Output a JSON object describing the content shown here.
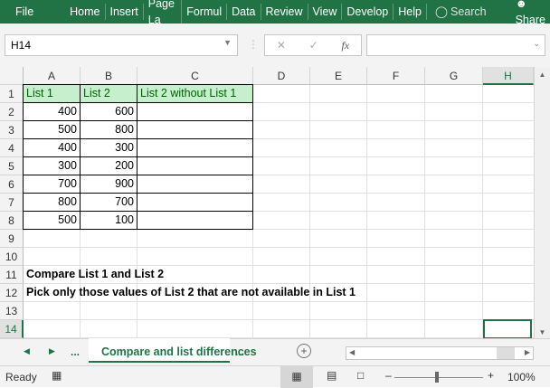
{
  "ribbon": {
    "tabs": [
      "File",
      "Home",
      "Insert",
      "Page La",
      "Formul",
      "Data",
      "Review",
      "View",
      "Develop",
      "Help"
    ],
    "search": "Search",
    "share": "Share"
  },
  "formula_bar": {
    "name_box": "H14",
    "value": ""
  },
  "columns": [
    "A",
    "B",
    "C",
    "D",
    "E",
    "F",
    "G",
    "H"
  ],
  "rows": [
    "1",
    "2",
    "3",
    "4",
    "5",
    "6",
    "7",
    "8",
    "9",
    "10",
    "11",
    "12",
    "13",
    "14"
  ],
  "table": {
    "headers": [
      "List 1",
      "List 2",
      "List 2 without List 1"
    ],
    "list1": [
      "400",
      "500",
      "400",
      "300",
      "700",
      "800",
      "500"
    ],
    "list2": [
      "600",
      "800",
      "300",
      "200",
      "900",
      "700",
      "100"
    ]
  },
  "notes": [
    "Compare List 1 and List 2",
    "Pick only those values of List 2 that are not available in List 1"
  ],
  "sheet_tabs": {
    "active": "Compare and list differences",
    "more": "..."
  },
  "status": {
    "text": "Ready",
    "zoom": "100%"
  },
  "colors": {
    "accent": "#217346",
    "header_fill": "#c6efce",
    "header_text": "#006100"
  }
}
